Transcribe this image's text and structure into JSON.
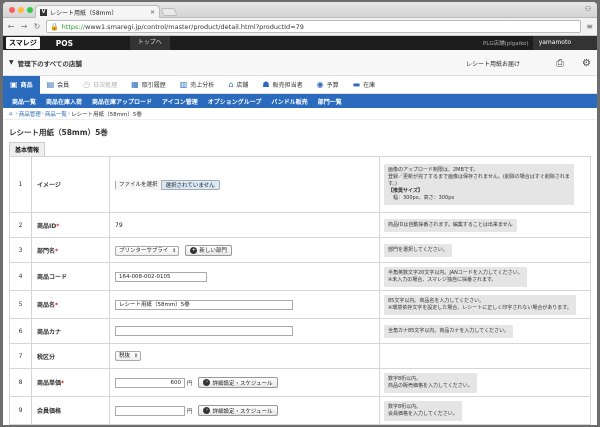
{
  "browser": {
    "tab_title": "レシート用紙（58mm）",
    "url_https": "https://",
    "url_rest": "www1.smaregi.jp/control/master/product/detail.html?productId=79"
  },
  "header": {
    "logo": "スマレジ",
    "app": "POS",
    "top_link": "トップへ",
    "shop": "PLG店舗(plgaiko)",
    "user": "yamamoto"
  },
  "storebar": {
    "store": "管理下のすべての店舗",
    "print_label": "レシート用紙お届け"
  },
  "main_nav": [
    {
      "label": "商品",
      "icon": "box-icon",
      "glyph": "▣",
      "state": "active"
    },
    {
      "label": "会員",
      "icon": "member-icon",
      "glyph": "▤",
      "state": ""
    },
    {
      "label": "日次処理",
      "icon": "daily-icon",
      "glyph": "◷",
      "state": "dim"
    },
    {
      "label": "取引履歴",
      "icon": "history-icon",
      "glyph": "▦",
      "state": ""
    },
    {
      "label": "売上分析",
      "icon": "chart-icon",
      "glyph": "▥",
      "state": ""
    },
    {
      "label": "店舗",
      "icon": "store-icon",
      "glyph": "⌂",
      "state": ""
    },
    {
      "label": "販売担当者",
      "icon": "staff-icon",
      "glyph": "☗",
      "state": ""
    },
    {
      "label": "予算",
      "icon": "budget-icon",
      "glyph": "◉",
      "state": ""
    },
    {
      "label": "在庫",
      "icon": "stock-icon",
      "glyph": "▬",
      "state": ""
    }
  ],
  "sub_nav": [
    "商品一覧",
    "商品在庫入荷",
    "商品在庫アップロード",
    "アイコン管理",
    "オプショングループ",
    "バンドル販売",
    "部門一覧"
  ],
  "breadcrumb": {
    "b1": "商品管理",
    "b2": "商品一覧",
    "current": "レシート用紙（58mm）5巻"
  },
  "page_title": "レシート用紙（58mm）5巻",
  "section_tab": "基本情報",
  "rows": {
    "image": {
      "num": "1",
      "label": "イメージ",
      "file_button": "ファイルを選択",
      "file_status": "選択されていません",
      "help1": "画像のアップロード制限は、2MBです。",
      "help2": "登録／更新が完了するまで画像は保存されません。(削除の場合はすぐ削除されま",
      "help3": "す。)",
      "help4": "【推奨サイズ】",
      "help5": "　幅：300px、高さ：300px"
    },
    "product_id": {
      "num": "2",
      "label": "商品ID",
      "req": "*",
      "value": "79",
      "help": "商品IDは自動採番されます。編集することは出来ません"
    },
    "dept": {
      "num": "3",
      "label": "部門名",
      "req": "*",
      "select": "プリンターサプライ",
      "button": "新しい部門",
      "help": "部門を選択してください。"
    },
    "code": {
      "num": "4",
      "label": "商品コード",
      "value": "164-008-002-0105",
      "help1": "半角英数文字20文字以内。JANコードを入力してください。",
      "help2": "※未入力の場合、スマレジ独自に採番されます。"
    },
    "name": {
      "num": "5",
      "label": "商品名",
      "req": "*",
      "value": "レシート用紙（58mm）5巻",
      "help1": "85文字以内。商品名を入力してください。",
      "help2": "※環境依存文字を設定した場合、レシートに正しく印字されない場合があります。"
    },
    "kana": {
      "num": "6",
      "label": "商品カナ",
      "value": "",
      "help": "全角カナ85文字以内。商品カナを入力してください。"
    },
    "tax": {
      "num": "7",
      "label": "税区分",
      "select": "税抜"
    },
    "price": {
      "num": "8",
      "label": "商品単価",
      "req": "*",
      "value": "600",
      "unit": "円",
      "button": "詳細設定・スケジュール",
      "help1": "数字8桁以内。",
      "help2": "商品の販売価格を入力してください。"
    },
    "member_price": {
      "num": "9",
      "label": "会員価格",
      "value": "",
      "unit": "円",
      "button": "詳細設定・スケジュール",
      "help1": "数字8桁以内。",
      "help2": "会員価格を入力してください。"
    }
  }
}
